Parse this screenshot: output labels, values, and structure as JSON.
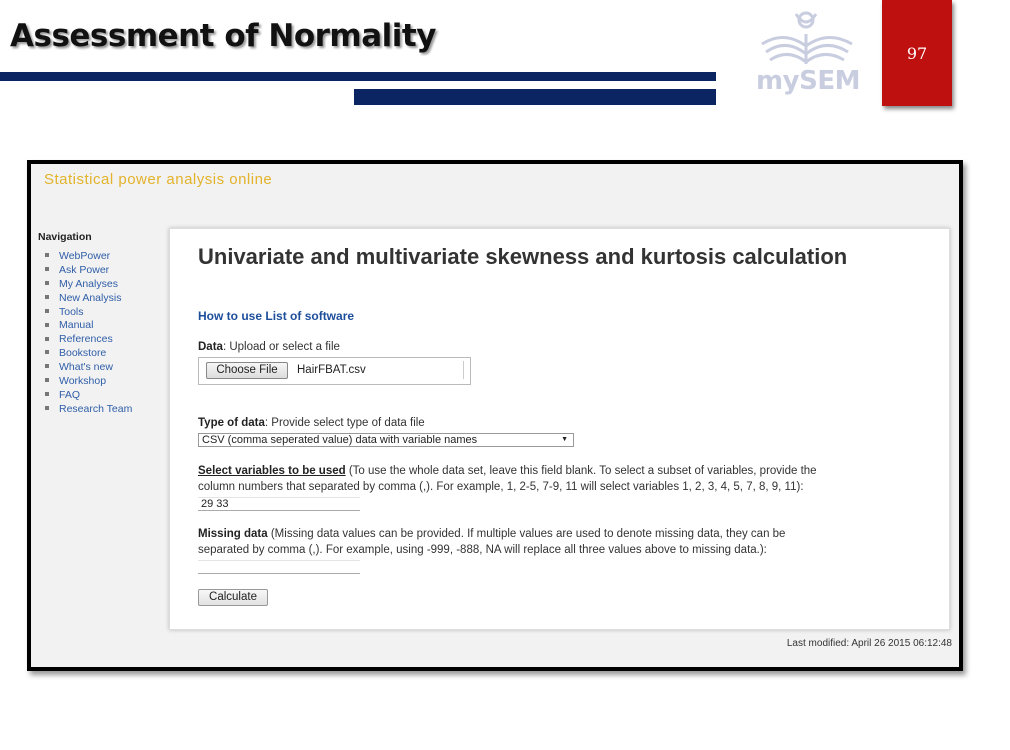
{
  "slide": {
    "title": "Assessment of Normality",
    "page_number": "97",
    "logo_text": "mySEM"
  },
  "screenshot": {
    "site_title": "Statistical power analysis online",
    "navigation": {
      "heading": "Navigation",
      "items": [
        {
          "label": "WebPower"
        },
        {
          "label": "Ask Power"
        },
        {
          "label": "My Analyses"
        },
        {
          "label": "New Analysis"
        },
        {
          "label": "Tools"
        },
        {
          "label": "Manual"
        },
        {
          "label": "References"
        },
        {
          "label": "Bookstore"
        },
        {
          "label": "What's new"
        },
        {
          "label": "Workshop"
        },
        {
          "label": "FAQ"
        },
        {
          "label": "Research Team"
        }
      ]
    },
    "main": {
      "title": "Univariate and multivariate skewness and kurtosis calculation",
      "how_to_use": "How to use",
      "list_of_software": "List of software",
      "data": {
        "label": "Data",
        "text": ": Upload or select a file",
        "choose_button": "Choose File",
        "file_name": "HairFBAT.csv"
      },
      "type_of_data": {
        "label": "Type of data",
        "text": ": Provide select type of data file",
        "selected": "CSV (comma seperated value) data with variable names"
      },
      "select_variables": {
        "label": "Select variables to be used",
        "text_line1": " (To use the whole data set, leave this field blank. To select a subset of variables, provide the",
        "text_line2": "column numbers that separated by comma (,). For example, 1, 2-5, 7-9, 11 will select variables 1, 2, 3, 4, 5, 7, 8, 9, 11):",
        "value": "29 33"
      },
      "missing_data": {
        "label": "Missing data",
        "text_line1": " (Missing data values can be provided. If multiple values are used to denote missing data, they can be",
        "text_line2": "separated by comma (,). For example, using -999, -888, NA will replace all three values above to missing data.):",
        "value": ""
      },
      "calculate_button": "Calculate"
    },
    "last_modified": "Last modified: April 26 2015 06:12:48"
  }
}
